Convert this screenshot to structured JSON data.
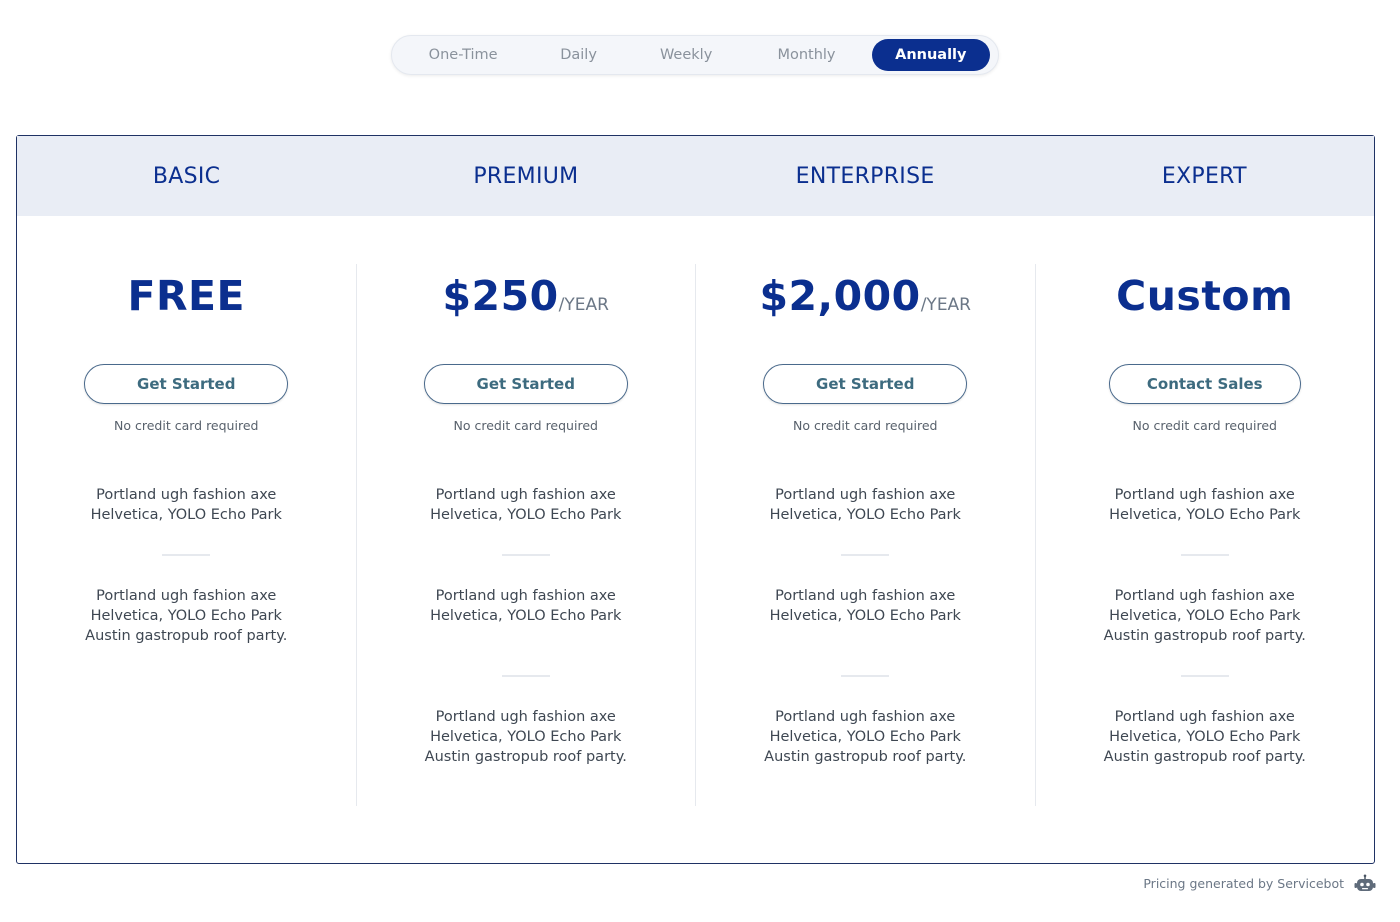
{
  "period_toggle": {
    "options": [
      "One-Time",
      "Daily",
      "Weekly",
      "Monthly",
      "Annually"
    ],
    "selected": "Annually"
  },
  "plans": [
    {
      "name": "BASIC",
      "price": "FREE",
      "unit": "",
      "button": "Get Started",
      "note": "No credit card required",
      "features": [
        "Portland ugh fashion axe Helvetica, YOLO Echo Park",
        "Portland ugh fashion axe Helvetica, YOLO Echo Park Austin gastropub roof party."
      ]
    },
    {
      "name": "PREMIUM",
      "price": "$250",
      "unit": "/YEAR",
      "button": "Get Started",
      "note": "No credit card required",
      "features": [
        "Portland ugh fashion axe Helvetica, YOLO Echo Park",
        "Portland ugh fashion axe Helvetica, YOLO Echo Park",
        "Portland ugh fashion axe Helvetica, YOLO Echo Park Austin gastropub roof party."
      ]
    },
    {
      "name": "ENTERPRISE",
      "price": "$2,000",
      "unit": "/YEAR",
      "button": "Get Started",
      "note": "No credit card required",
      "features": [
        "Portland ugh fashion axe Helvetica, YOLO Echo Park",
        "Portland ugh fashion axe Helvetica, YOLO Echo Park",
        "Portland ugh fashion axe Helvetica, YOLO Echo Park Austin gastropub roof party."
      ]
    },
    {
      "name": "EXPERT",
      "price": "Custom",
      "unit": "",
      "button": "Contact Sales",
      "note": "No credit card required",
      "features": [
        "Portland ugh fashion axe Helvetica, YOLO Echo Park",
        "Portland ugh fashion axe Helvetica, YOLO Echo Park Austin gastropub roof party.",
        "Portland ugh fashion axe Helvetica, YOLO Echo Park Austin gastropub roof party."
      ]
    }
  ],
  "footer": {
    "credit": "Pricing generated by Servicebot",
    "icon": "robot-icon"
  },
  "colors": {
    "accent": "#0b2f8f",
    "header_bg": "#e9edf5",
    "border": "#1f3264",
    "button_text": "#3d6b7f"
  }
}
